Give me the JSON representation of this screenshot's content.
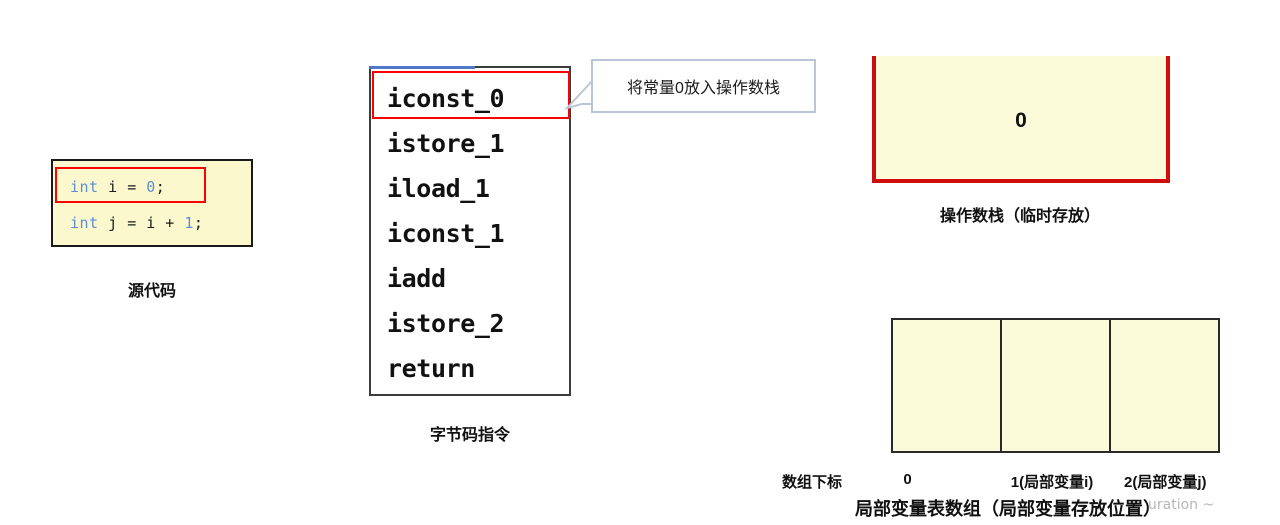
{
  "top_cut_text": "· · · · · · · · · · · · · · · · · · · · · · · · · · · · · · · · · · · · · · · · · · · · · · · · · · ·",
  "source_code": {
    "label": "源代码",
    "lines": [
      {
        "kw": "int",
        "rest_id": " i ",
        "op": "= ",
        "num": "0",
        "end": ";"
      },
      {
        "kw": "int",
        "rest_id": " j ",
        "op": "= i + ",
        "num": "1",
        "end": ";"
      }
    ],
    "line1_full": "int i = 0;",
    "line2_full": "int j = i + 1;",
    "highlighted_line": "int i = 0;",
    "keyword_color": "#5b8fd4",
    "number_color": "#5b8fd4",
    "background": "#fbf8cd",
    "highlight_color": "#ff0000"
  },
  "bytecode": {
    "label": "字节码指令",
    "instructions": [
      "iconst_0",
      "istore_1",
      "iload_1",
      "iconst_1",
      "iadd",
      "istore_2",
      "return"
    ],
    "highlighted_index": 0,
    "highlight_color": "#ff0000"
  },
  "callout": {
    "text": "将常量0放入操作数栈",
    "border_color": "#b9c6d8"
  },
  "operand_stack": {
    "label": "操作数栈（临时存放）",
    "value": "0",
    "border_color": "#d00d0d",
    "fill_color": "#fbfbd9"
  },
  "local_variable_table": {
    "label": "局部变量表数组（局部变量存放位置）",
    "index_caption": "数组下标",
    "cells": [
      {
        "index": "0",
        "value": ""
      },
      {
        "index": "1(局部变量i)",
        "value": ""
      },
      {
        "index": "2(局部变量j)",
        "value": ""
      }
    ],
    "border_color": "#2a2a2a",
    "fill_color": "#fbfbd9"
  },
  "watermark": "uration ~"
}
